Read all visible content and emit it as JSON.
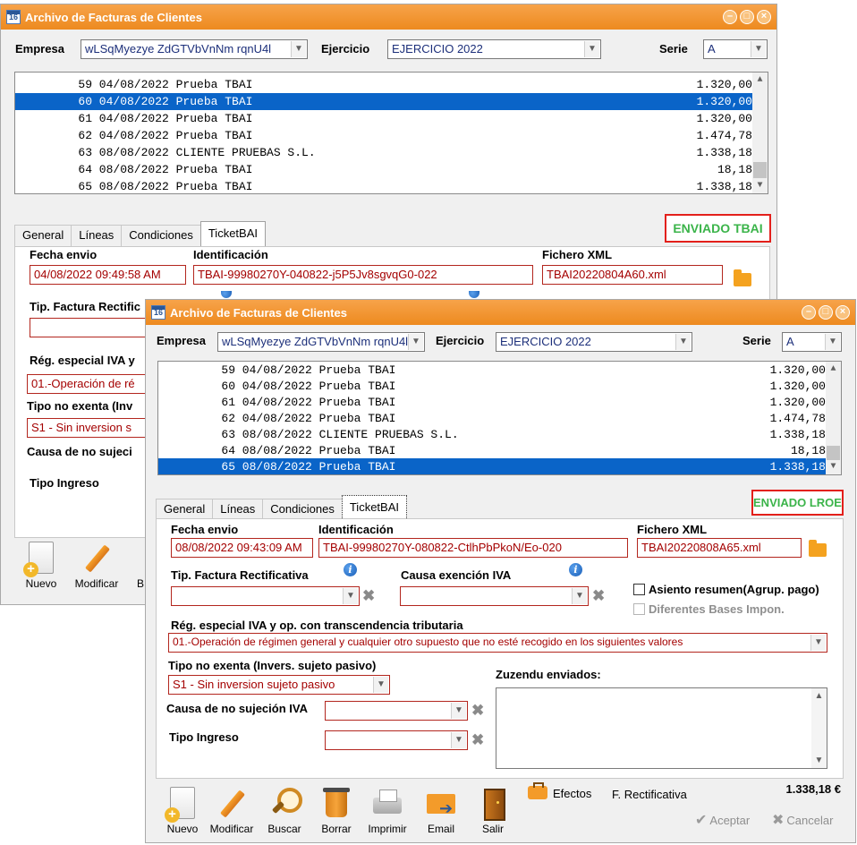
{
  "window1": {
    "title": "Archivo de Facturas de Clientes",
    "icon_text": "16",
    "empresa_label": "Empresa",
    "empresa_value": "wLSqMyezye ZdGTVbVnNm rqnU4l",
    "ejercicio_label": "Ejercicio",
    "ejercicio_value": "EJERCICIO 2022",
    "serie_label": "Serie",
    "serie_value": "A",
    "rows": [
      {
        "num": "59",
        "text": "04/08/2022 Prueba TBAI",
        "amount": "1.320,00",
        "selected": false
      },
      {
        "num": "60",
        "text": "04/08/2022 Prueba TBAI",
        "amount": "1.320,00",
        "selected": true
      },
      {
        "num": "61",
        "text": "04/08/2022 Prueba TBAI",
        "amount": "1.320,00",
        "selected": false
      },
      {
        "num": "62",
        "text": "04/08/2022 Prueba TBAI",
        "amount": "1.474,78",
        "selected": false
      },
      {
        "num": "63",
        "text": "08/08/2022 CLIENTE PRUEBAS S.L.",
        "amount": "1.338,18",
        "selected": false
      },
      {
        "num": "64",
        "text": "08/08/2022 Prueba TBAI",
        "amount": "18,18",
        "selected": false
      },
      {
        "num": "65",
        "text": "08/08/2022 Prueba TBAI",
        "amount": "1.338,18",
        "selected": false
      }
    ],
    "tabs": [
      "General",
      "Líneas",
      "Condiciones",
      "TicketBAI"
    ],
    "status": "ENVIADO TBAI",
    "fecha_label": "Fecha envio",
    "fecha_value": "04/08/2022 09:49:58 AM",
    "ident_label": "Identificación",
    "ident_value": "TBAI-99980270Y-040822-j5P5Jv8sgvqG0-022",
    "xml_label": "Fichero XML",
    "xml_value": "TBAI20220804A60.xml",
    "tip_label": "Tip. Factura Rectific",
    "reg_label": "Rég. especial IVA y",
    "reg_value": "01.-Operación de ré",
    "tipo_label": "Tipo no exenta (Inv",
    "tipo_value": "S1 - Sin inversion s",
    "causa_label": "Causa de no sujeci",
    "ingreso_label": "Tipo Ingreso",
    "tools": [
      "Nuevo",
      "Modificar",
      "B"
    ]
  },
  "window2": {
    "title": "Archivo de Facturas de Clientes",
    "icon_text": "16",
    "empresa_label": "Empresa",
    "empresa_value": "wLSqMyezye ZdGTVbVnNm rqnU4l",
    "ejercicio_label": "Ejercicio",
    "ejercicio_value": "EJERCICIO 2022",
    "serie_label": "Serie",
    "serie_value": "A",
    "rows": [
      {
        "num": "59",
        "text": "04/08/2022 Prueba TBAI",
        "amount": "1.320,00",
        "selected": false
      },
      {
        "num": "60",
        "text": "04/08/2022 Prueba TBAI",
        "amount": "1.320,00",
        "selected": false
      },
      {
        "num": "61",
        "text": "04/08/2022 Prueba TBAI",
        "amount": "1.320,00",
        "selected": false
      },
      {
        "num": "62",
        "text": "04/08/2022 Prueba TBAI",
        "amount": "1.474,78",
        "selected": false
      },
      {
        "num": "63",
        "text": "08/08/2022 CLIENTE PRUEBAS S.L.",
        "amount": "1.338,18",
        "selected": false
      },
      {
        "num": "64",
        "text": "08/08/2022 Prueba TBAI",
        "amount": "18,18",
        "selected": false
      },
      {
        "num": "65",
        "text": "08/08/2022 Prueba TBAI",
        "amount": "1.338,18",
        "selected": true
      }
    ],
    "tabs": [
      "General",
      "Líneas",
      "Condiciones",
      "TicketBAI"
    ],
    "status": "ENVIADO LROE",
    "fecha_label": "Fecha envio",
    "fecha_value": "08/08/2022 09:43:09 AM",
    "ident_label": "Identificación",
    "ident_value": "TBAI-99980270Y-080822-CtlhPbPkoN/Eo-020",
    "xml_label": "Fichero XML",
    "xml_value": "TBAI20220808A65.xml",
    "tip_label": "Tip. Factura Rectificativa",
    "causa_exencion_label": "Causa exención IVA",
    "asiento_label": "Asiento resumen(Agrup. pago)",
    "bases_label": "Diferentes Bases Impon.",
    "reg_label": "Rég. especial IVA y op. con transcendencia tributaria",
    "reg_value": "01.-Operación de régimen general y cualquier otro supuesto que no esté recogido en los siguientes valores",
    "tipo_label": "Tipo no exenta (Invers. sujeto pasivo)",
    "tipo_value": "S1 - Sin inversion sujeto pasivo",
    "zuzendu_label": "Zuzendu enviados:",
    "causa_label": "Causa de no sujeción IVA",
    "ingreso_label": "Tipo Ingreso",
    "tools": [
      "Nuevo",
      "Modificar",
      "Buscar",
      "Borrar",
      "Imprimir",
      "Email",
      "Salir"
    ],
    "efectos_label": "Efectos",
    "rectificativa_label": "F. Rectificativa",
    "total": "1.338,18 €",
    "aceptar_label": "Aceptar",
    "cancelar_label": "Cancelar"
  },
  "colors": {
    "titlebar": "#ed8a1f",
    "selection": "#0a64c8",
    "status_border": "#e3201b",
    "status_text": "#3bb44a",
    "field_border_red": "#b3261e"
  }
}
